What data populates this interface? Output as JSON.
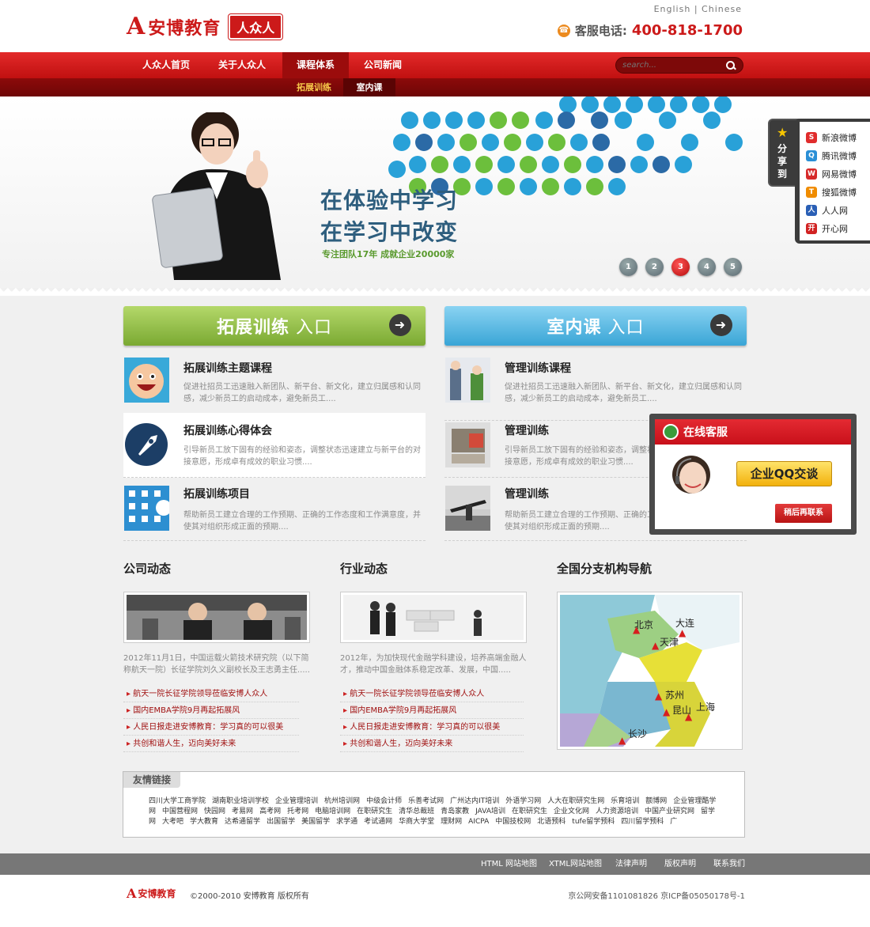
{
  "header": {
    "logo_mark": "A",
    "logo_text": "安博教育",
    "logo_tag": "人众人",
    "lang_en": "English",
    "lang_sep": "|",
    "lang_cn": "Chinese",
    "hotline_label": "客服电话:",
    "hotline_number": "400-818-1700"
  },
  "nav": {
    "items": [
      "人众人首页",
      "关于人众人",
      "课程体系",
      "公司新闻"
    ],
    "sub_items": [
      "拓展训练",
      "室内课"
    ],
    "search_placeholder": "search..."
  },
  "banner": {
    "slogan_1": "在体验中学习",
    "slogan_2": "在学习中改变",
    "sub": "专注团队17年 成就企业20000家",
    "pages": [
      "1",
      "2",
      "3",
      "4",
      "5"
    ],
    "active_page": 3
  },
  "share": {
    "tab": "分享到",
    "items": [
      {
        "label": "新浪微博",
        "color": "#e02c2c",
        "glyph": "S"
      },
      {
        "label": "腾讯微博",
        "color": "#2a8fd6",
        "glyph": "Q"
      },
      {
        "label": "网易微博",
        "color": "#d62a2a",
        "glyph": "W"
      },
      {
        "label": "搜狐微博",
        "color": "#f08c00",
        "glyph": "T"
      },
      {
        "label": "人人网",
        "color": "#2a5fb5",
        "glyph": "人"
      },
      {
        "label": "开心网",
        "color": "#d12222",
        "glyph": "开"
      }
    ]
  },
  "entries": {
    "left_title": "拓展训练",
    "left_suffix": "入口",
    "right_title": "室内课",
    "right_suffix": "入口"
  },
  "courses_left": [
    {
      "title": "拓展训练主题课程",
      "desc": "促进社招员工迅速融入新团队、新平台、新文化，建立归属感和认同感，减少新员工的启动成本，避免新员工....",
      "icon": "smiley-icon"
    },
    {
      "title": "拓展训练心得体会",
      "desc": "引导新员工放下固有的经验和姿态，调整状态迅速建立与新平台的对接意愿，形成卓有成效的职业习惯....",
      "icon": "rocket-icon"
    },
    {
      "title": "拓展训练项目",
      "desc": "帮助新员工建立合理的工作预期、正确的工作态度和工作满意度，并使其对组织形成正面的预期....",
      "icon": "apps-icon"
    }
  ],
  "courses_right": [
    {
      "title": "管理训练课程",
      "desc": "促进社招员工迅速融入新团队、新平台、新文化，建立归属感和认同感，减少新员工的启动成本，避免新员工....",
      "icon": "meeting-photo"
    },
    {
      "title": "管理训练",
      "desc": "引导新员工放下固有的经验和姿态，调整状态迅速建立与新平台的对接意愿，形成卓有成效的职业习惯....",
      "icon": "office-photo"
    },
    {
      "title": "管理训练",
      "desc": "帮助新员工建立合理的工作预期、正确的工作态度和工作满意度，并使其对组织形成正面的预期....",
      "icon": "surfer-photo"
    }
  ],
  "sections": {
    "company": "公司动态",
    "industry": "行业动态",
    "map": "全国分支机构导航"
  },
  "company_news": {
    "desc": "2012年11月1日，中国运载火箭技术研究院（以下简称航天一院）长征学院刘久义副校长及王志勇主任.....",
    "items": [
      "航天一院长征学院领导莅临安博人众人",
      "国内EMBA学院9月再起拓展风",
      "人民日报走进安博教育：学习真的可以很美",
      "共创和谐人生，迈向美好未来"
    ]
  },
  "industry_news": {
    "desc": "2012年，为加快现代金融学科建设，培养高端金融人才，推动中国金融体系稳定改革、发展，中国.....",
    "items": [
      "航天一院长征学院领导莅临安博人众人",
      "国内EMBA学院9月再起拓展风",
      "人民日报走进安博教育：学习真的可以很美",
      "共创和谐人生，迈向美好未来"
    ]
  },
  "map_labels": [
    "北京",
    "大连",
    "天津",
    "苏州",
    "昆山",
    "上海",
    "长沙"
  ],
  "friend": {
    "title": "友情链接",
    "links": [
      "四川大学工商学院",
      "湖南职业培训学校",
      "企业管理培训",
      "杭州培训网",
      "中级会计师",
      "乐善考试网",
      "广州达内IT培训",
      "外语学习网",
      "人大在职研究生网",
      "乐育培训",
      "额博网",
      "企业管理酷学网",
      "中国营程网",
      "快园网",
      "考易网",
      "高考网",
      "托考网",
      "电脑培训网",
      "在职研究生",
      "清华总裁班",
      "青岛家教",
      "JAVA培训",
      "在职研究生",
      "企业文化网",
      "人力资源培训",
      "中国产业研究网",
      "留学网",
      "大考吧",
      "学大教育",
      "达希通留学",
      "出国留学",
      "美国留学",
      "求学通",
      "考试通网",
      "华商大学堂",
      "理财网",
      "AICPA",
      "中国技校网",
      "北语预科",
      "tufe留学预科",
      "四川留学预科",
      "广"
    ]
  },
  "footer": {
    "links": [
      "HTML 网站地图",
      "XTML网站地图",
      "法律声明",
      "版权声明",
      "联系我们"
    ],
    "copyright": "©2000-2010 安博教育 版权所有",
    "icp": "京公网安备1101081826 京ICP备05050178号-1",
    "logo": "安博教育"
  },
  "chat": {
    "title": "在线客服",
    "qq_button": "企业QQ交谈",
    "later_button": "稍后再联系"
  }
}
